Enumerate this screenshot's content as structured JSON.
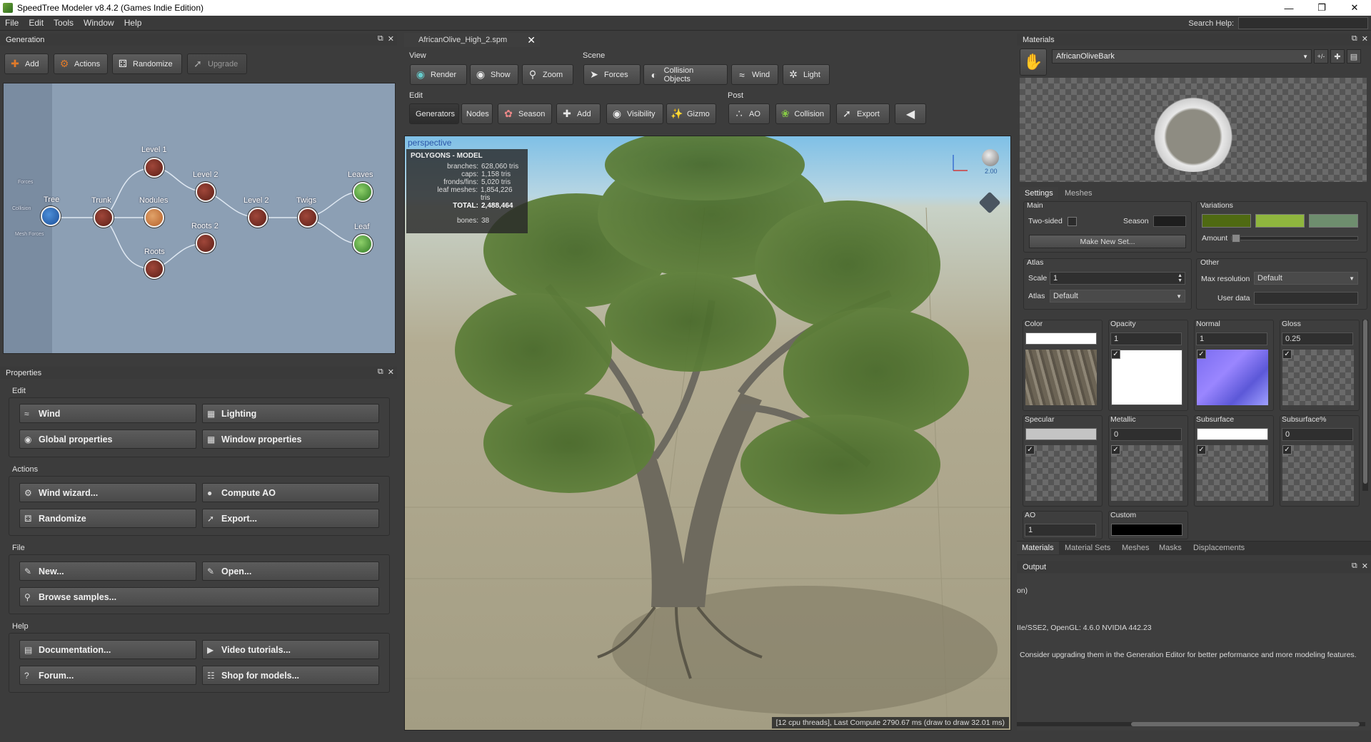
{
  "window": {
    "title": "SpeedTree Modeler v8.4.2 (Games Indie Edition)"
  },
  "menu": [
    "File",
    "Edit",
    "Tools",
    "Window",
    "Help"
  ],
  "search_label": "Search Help:",
  "generation": {
    "title": "Generation",
    "buttons": {
      "add": "Add",
      "actions": "Actions",
      "randomize": "Randomize",
      "upgrade": "Upgrade"
    },
    "nodes": {
      "tree": "Tree",
      "trunk": "Trunk",
      "level1": "Level 1",
      "level2a": "Level 2",
      "nodules": "Nodules",
      "level2b": "Level 2",
      "roots2": "Roots 2",
      "roots": "Roots",
      "twigs": "Twigs",
      "leaves": "Leaves",
      "leaf": "Leaf"
    },
    "sidebar": {
      "forces": "Forces",
      "collision": "Collision",
      "mesh_forces": "Mesh Forces"
    }
  },
  "properties": {
    "title": "Properties",
    "groups": {
      "edit": {
        "label": "Edit",
        "buttons": [
          "Wind",
          "Lighting",
          "Global properties",
          "Window properties"
        ]
      },
      "actions": {
        "label": "Actions",
        "buttons": [
          "Wind wizard...",
          "Compute AO",
          "Randomize",
          "Export..."
        ]
      },
      "file": {
        "label": "File",
        "buttons": [
          "New...",
          "Open...",
          "Browse samples..."
        ]
      },
      "help": {
        "label": "Help",
        "buttons": [
          "Documentation...",
          "Video tutorials...",
          "Forum...",
          "Shop for models..."
        ]
      }
    }
  },
  "document_tab": "AfricanOlive_High_2.spm",
  "toolbar": {
    "view": {
      "label": "View",
      "buttons": [
        "Render",
        "Show",
        "Zoom"
      ]
    },
    "scene": {
      "label": "Scene",
      "buttons": [
        "Forces",
        "Collision Objects",
        "Wind",
        "Light"
      ]
    },
    "edit": {
      "label": "Edit",
      "buttons": [
        "Generators",
        "Nodes",
        "Season",
        "Add",
        "Visibility",
        "Gizmo"
      ]
    },
    "post": {
      "label": "Post",
      "buttons": [
        "AO",
        "Collision",
        "Export"
      ]
    }
  },
  "viewport": {
    "label": "perspective",
    "stats": {
      "title": "POLYGONS - MODEL",
      "rows": [
        {
          "k": "branches:",
          "v": "628,060 tris"
        },
        {
          "k": "caps:",
          "v": "1,158 tris"
        },
        {
          "k": "fronds/fins:",
          "v": "5,020 tris"
        },
        {
          "k": "leaf meshes:",
          "v": "1,854,226 tris"
        },
        {
          "k": "TOTAL:",
          "v": "2,488,464"
        },
        {
          "k": "bones:",
          "v": "38"
        }
      ]
    },
    "light_value": "2.00",
    "status": "[12 cpu threads], Last Compute 2790.67 ms (draw to draw 32.01 ms)"
  },
  "materials": {
    "title": "Materials",
    "selected": "AfricanOliveBark",
    "plusminus": "+/-",
    "tabs": [
      "Settings",
      "Meshes"
    ],
    "main": {
      "label": "Main",
      "two_sided": "Two-sided",
      "season": "Season",
      "make_new_set": "Make New Set..."
    },
    "variations": {
      "label": "Variations",
      "amount": "Amount",
      "colors": [
        "#4f6a12",
        "#8fb63e",
        "#6e8e6e"
      ]
    },
    "atlas": {
      "label": "Atlas",
      "scale_label": "Scale",
      "scale_value": "1",
      "atlas_label": "Atlas",
      "atlas_value": "Default"
    },
    "other": {
      "label": "Other",
      "maxres_label": "Max resolution",
      "maxres_value": "Default",
      "userdata_label": "User data"
    },
    "channels": [
      {
        "name": "Color",
        "value": ""
      },
      {
        "name": "Opacity",
        "value": "1"
      },
      {
        "name": "Normal",
        "value": "1"
      },
      {
        "name": "Gloss",
        "value": "0.25"
      },
      {
        "name": "Specular",
        "value": ""
      },
      {
        "name": "Metallic",
        "value": "0"
      },
      {
        "name": "Subsurface",
        "value": ""
      },
      {
        "name": "Subsurface%",
        "value": "0"
      },
      {
        "name": "AO",
        "value": "1"
      },
      {
        "name": "Custom",
        "value": ""
      }
    ],
    "bottom_tabs": [
      "Materials",
      "Material Sets",
      "Meshes",
      "Masks",
      "Displacements"
    ]
  },
  "output": {
    "title": "Output",
    "lines": [
      "on)",
      "IIe/SSE2, OpenGL: 4.6.0 NVIDIA 442.23",
      "Consider upgrading them in the Generation Editor for better peformance and more modeling features."
    ]
  }
}
